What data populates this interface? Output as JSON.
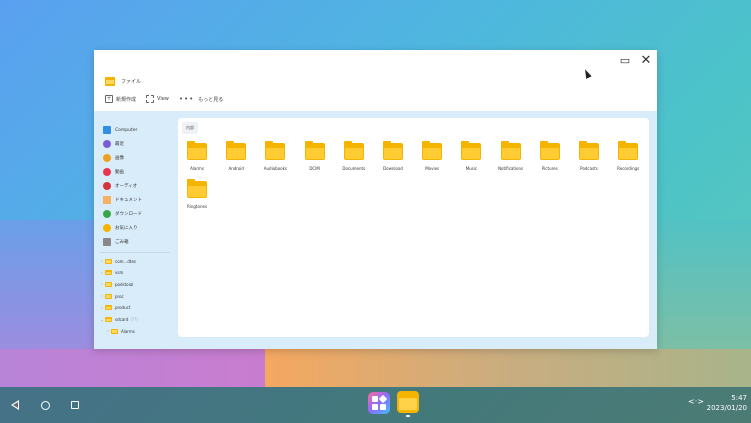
{
  "window": {
    "restore_icon": "restore-icon",
    "close_icon": "close-icon",
    "restore_glyph": "▭",
    "close_glyph": "✕"
  },
  "app": {
    "title": "ファイル"
  },
  "toolbar": {
    "new_label": "新規作成",
    "view_label": "View",
    "more_label": "もっと見る"
  },
  "sidebar": {
    "items": [
      {
        "label": "Computer",
        "icon": "computer-icon",
        "color": "#2f8fe0"
      },
      {
        "label": "最近",
        "icon": "recent-icon",
        "color": "#7b5cd6"
      },
      {
        "label": "画像",
        "icon": "image-icon",
        "color": "#f0a020"
      },
      {
        "label": "動画",
        "icon": "video-icon",
        "color": "#e8384f"
      },
      {
        "label": "オーディオ",
        "icon": "audio-icon",
        "color": "#d6333b"
      },
      {
        "label": "ドキュメント",
        "icon": "document-icon",
        "color": "#f5b060"
      },
      {
        "label": "ダウンロード",
        "icon": "download-icon",
        "color": "#3aa64a"
      },
      {
        "label": "お気に入り",
        "icon": "star-icon",
        "color": "#f5b400"
      },
      {
        "label": "ごみ箱",
        "icon": "trash-icon",
        "color": "#888888"
      }
    ],
    "tree": [
      {
        "label": "com...dtes",
        "sub": ""
      },
      {
        "label": "vsm",
        "sub": ""
      },
      {
        "label": "podstoial",
        "sub": ""
      },
      {
        "label": "proc",
        "sub": ""
      },
      {
        "label": "product",
        "sub": ""
      },
      {
        "label": "sdcard",
        "sub": "(??)"
      },
      {
        "label": "Alarms",
        "sub": ""
      }
    ]
  },
  "breadcrumb": {
    "label": "内部"
  },
  "folders": [
    "Alarms",
    "Android",
    "Audiobooks",
    "DCIM",
    "Documents",
    "Download",
    "Movies",
    "Music",
    "Notifications",
    "Pictures",
    "Podcasts",
    "Recordings",
    "Ringtones"
  ],
  "taskbar": {
    "time": "5:47",
    "date": "2023/01/20",
    "net_glyph": "<·>"
  }
}
